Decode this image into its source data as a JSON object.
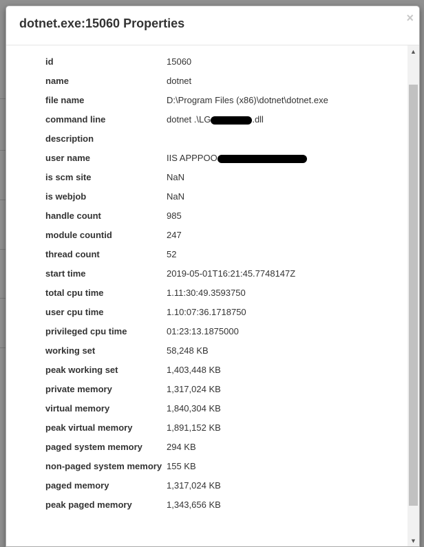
{
  "dialog": {
    "title": "dotnet.exe:15060 Properties",
    "close_label": "×"
  },
  "properties": [
    {
      "key": "id",
      "value": "15060"
    },
    {
      "key": "name",
      "value": "dotnet"
    },
    {
      "key": "file name",
      "value": "D:\\Program Files (x86)\\dotnet\\dotnet.exe"
    },
    {
      "key": "command line",
      "value": "dotnet .\\LG",
      "suffix": ".dll",
      "redacted": true
    },
    {
      "key": "description",
      "value": ""
    },
    {
      "key": "user name",
      "value": "IIS APPPOO",
      "redacted": true
    },
    {
      "key": "is scm site",
      "value": "NaN"
    },
    {
      "key": "is webjob",
      "value": "NaN"
    },
    {
      "key": "handle count",
      "value": "985"
    },
    {
      "key": "module countid",
      "value": "247"
    },
    {
      "key": "thread count",
      "value": "52"
    },
    {
      "key": "start time",
      "value": "2019-05-01T16:21:45.7748147Z"
    },
    {
      "key": "total cpu time",
      "value": "1.11:30:49.3593750"
    },
    {
      "key": "user cpu time",
      "value": "1.10:07:36.1718750"
    },
    {
      "key": "privileged cpu time",
      "value": "01:23:13.1875000"
    },
    {
      "key": "working set",
      "value": "58,248 KB"
    },
    {
      "key": "peak working set",
      "value": "1,403,448 KB"
    },
    {
      "key": "private memory",
      "value": "1,317,024 KB"
    },
    {
      "key": "virtual memory",
      "value": "1,840,304 KB"
    },
    {
      "key": "peak virtual memory",
      "value": "1,891,152 KB"
    },
    {
      "key": "paged system memory",
      "value": "294 KB"
    },
    {
      "key": "non-paged system memory",
      "value": "155 KB"
    },
    {
      "key": "paged memory",
      "value": "1,317,024 KB"
    },
    {
      "key": "peak paged memory",
      "value": "1,343,656 KB"
    }
  ],
  "scrollbar": {
    "up_icon": "triangle-up",
    "down_icon": "triangle-down"
  },
  "colors": {
    "overlay": "#8c8c8c",
    "text": "#333333",
    "redaction": "#000000"
  }
}
